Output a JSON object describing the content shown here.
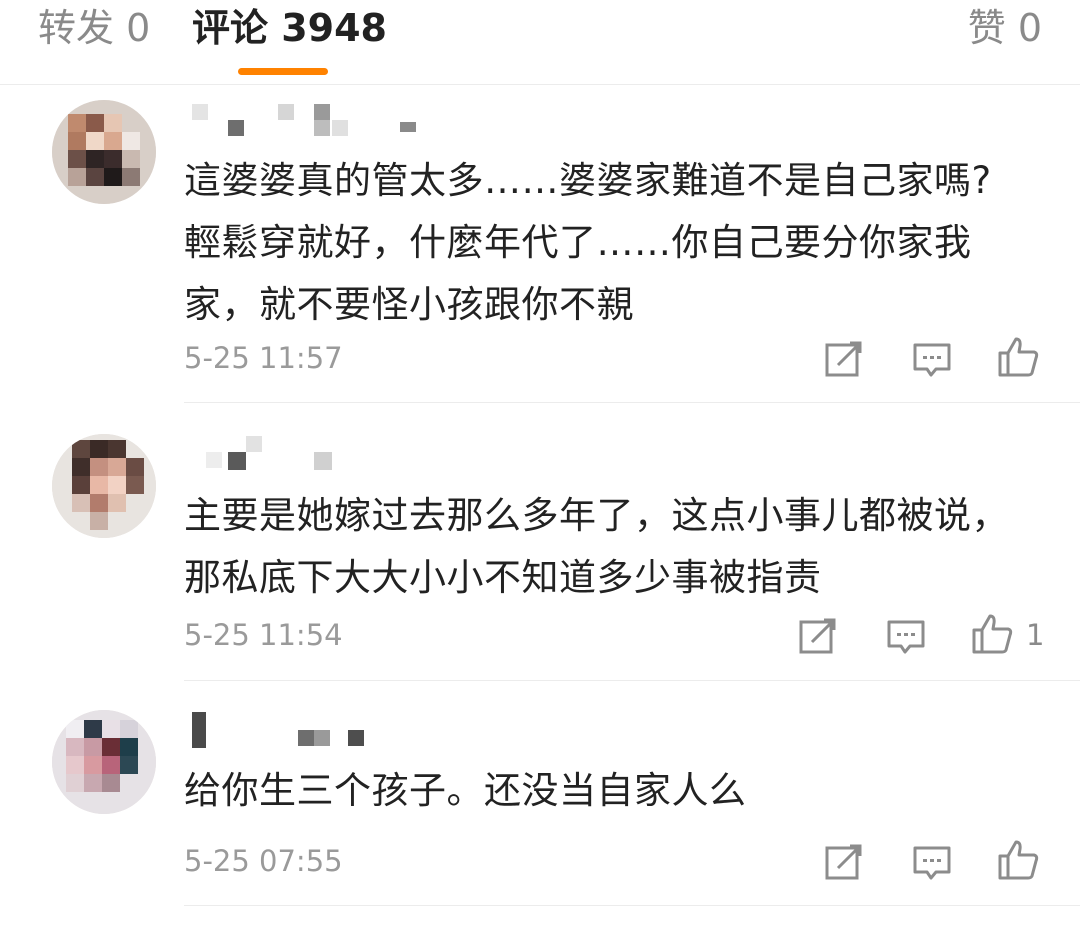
{
  "tabs": {
    "repost_label": "转发 0",
    "comments_label": "评论 3948",
    "likes_label": "赞 0",
    "active_color": "#ff8200"
  },
  "comments": [
    {
      "text_lines": [
        "這婆婆真的管太多……婆婆家難道不是自己家嗎?",
        "輕鬆穿就好，什麼年代了……你自己要分你家我",
        "家，就不要怪小孩跟你不親"
      ],
      "time": "5-25 11:57",
      "like_count": "",
      "icons": [
        "repost-icon",
        "comment-icon",
        "like-icon"
      ]
    },
    {
      "text_lines": [
        "主要是她嫁过去那么多年了，这点小事儿都被说，",
        "那私底下大大小小不知道多少事被指责"
      ],
      "time": "5-25 11:54",
      "like_count": "1",
      "icons": [
        "repost-icon",
        "comment-icon",
        "like-icon"
      ]
    },
    {
      "text_lines": [
        "给你生三个孩子。还没当自家人么"
      ],
      "time": "5-25 07:55",
      "like_count": "",
      "icons": [
        "repost-icon",
        "comment-icon",
        "like-icon"
      ]
    }
  ]
}
